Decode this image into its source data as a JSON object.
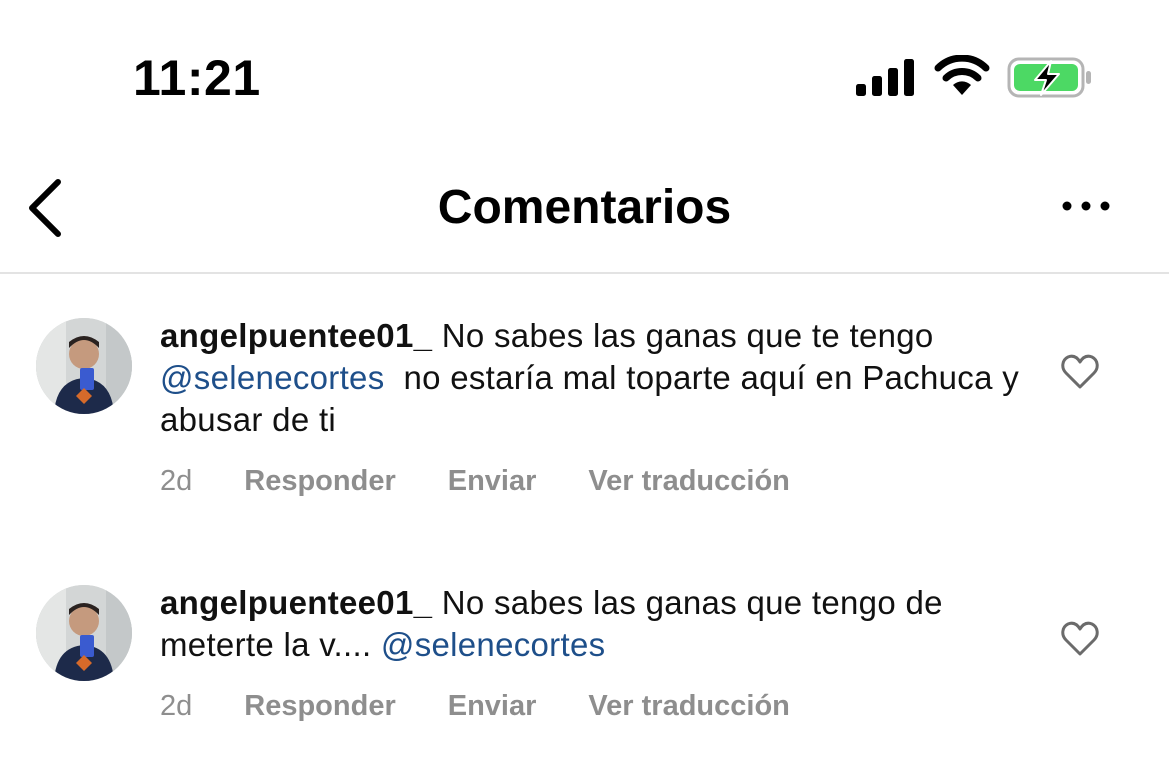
{
  "status_bar": {
    "time": "11:21"
  },
  "header": {
    "title": "Comentarios"
  },
  "comments": [
    {
      "username": "angelpuentee01_",
      "text_before": "No sabes las ganas que te tengo",
      "mention": "@selenecortes",
      "text_after": "no estaría mal toparte aquí en Pachuca y abusar de ti",
      "age": "2d",
      "reply_label": "Responder",
      "send_label": "Enviar",
      "translate_label": "Ver traducción"
    },
    {
      "username": "angelpuentee01_",
      "text_before": "No sabes las ganas que tengo de meterte la v....",
      "mention": "@selenecortes",
      "text_after": "",
      "age": "2d",
      "reply_label": "Responder",
      "send_label": "Enviar",
      "translate_label": "Ver traducción"
    }
  ],
  "colors": {
    "mention": "#1e4f8a",
    "meta": "#8e8e8e",
    "battery_fill": "#4cd964"
  },
  "icons": {
    "back": "chevron-left-icon",
    "more": "more-horizontal-icon",
    "like": "heart-outline-icon"
  }
}
